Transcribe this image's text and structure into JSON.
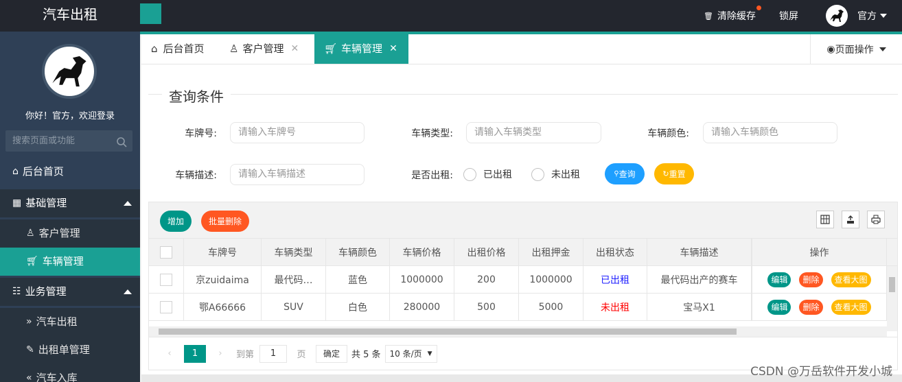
{
  "app": {
    "title": "汽车出租"
  },
  "topbar": {
    "clear_cache": "清除缓存",
    "lock_screen": "锁屏",
    "user": "官方"
  },
  "sidebar": {
    "welcome": "你好！官方，欢迎登录",
    "search_placeholder": "搜索页面或功能",
    "items": [
      {
        "label": "后台首页",
        "icon": "home-icon"
      },
      {
        "label": "基础管理",
        "icon": "grid-icon",
        "expanded": true
      },
      {
        "label": "客户管理",
        "icon": "user-icon"
      },
      {
        "label": "车辆管理",
        "icon": "cart-icon",
        "active": true
      },
      {
        "label": "业务管理",
        "icon": "list-icon",
        "expanded": true
      },
      {
        "label": "汽车出租",
        "icon": "double-right-icon"
      },
      {
        "label": "出租单管理",
        "icon": "edit-icon"
      },
      {
        "label": "汽车入库",
        "icon": "double-left-icon"
      }
    ]
  },
  "tabs": [
    {
      "label": "后台首页",
      "closable": false
    },
    {
      "label": "客户管理",
      "closable": true
    },
    {
      "label": "车辆管理",
      "closable": true,
      "active": true
    }
  ],
  "page_ops": "页面操作",
  "query": {
    "legend": "查询条件",
    "plate_label": "车牌号:",
    "plate_placeholder": "请输入车牌号",
    "type_label": "车辆类型:",
    "type_placeholder": "请输入车辆类型",
    "color_label": "车辆颜色:",
    "color_placeholder": "请输入车辆颜色",
    "desc_label": "车辆描述:",
    "desc_placeholder": "请输入车辆描述",
    "rented_label": "是否出租:",
    "opt_rented": "已出租",
    "opt_not_rented": "未出租",
    "search_btn": "查询",
    "reset_btn": "重置"
  },
  "toolbar": {
    "add": "增加",
    "batch_delete": "批量删除"
  },
  "table": {
    "columns": [
      "车牌号",
      "车辆类型",
      "车辆颜色",
      "车辆价格",
      "出租价格",
      "出租押金",
      "出租状态",
      "车辆描述",
      "操作"
    ],
    "rows": [
      [
        "京zuidaima",
        "最代码…",
        "蓝色",
        "1000000",
        "200",
        "1000000",
        "已出租",
        "最代码出产的赛车"
      ],
      [
        "鄂A66666",
        "SUV",
        "白色",
        "280000",
        "500",
        "5000",
        "未出租",
        "宝马X1"
      ]
    ],
    "actions": {
      "edit": "编辑",
      "delete": "删除",
      "view": "查看大图"
    }
  },
  "pager": {
    "current": "1",
    "goto_label": "到第",
    "goto_value": "1",
    "page_unit": "页",
    "confirm": "确定",
    "total": "共 5 条",
    "page_size": "10 条/页"
  },
  "watermark": "CSDN @万岳软件开发小城",
  "colors": {
    "accent": "#1aa094",
    "orange": "#ff5722",
    "yellow": "#ffb800",
    "blue": "#1e9fff",
    "dark": "#23262e"
  }
}
